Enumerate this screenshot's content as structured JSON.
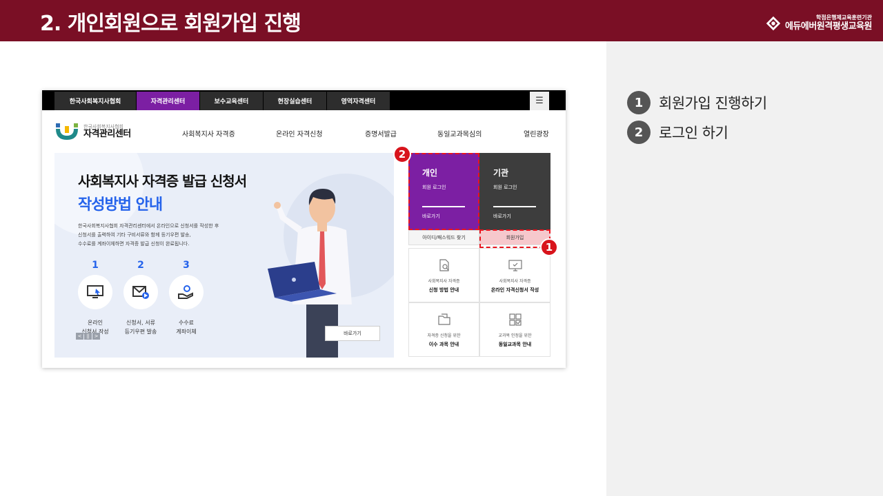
{
  "slide": {
    "title": "2. 개인회원으로 회원가입 진행",
    "brand_sub": "학점은행제교육훈련기관",
    "brand_main": "에듀에버원격평생교육원",
    "colors": {
      "header": "#7a0f25",
      "accent_purple": "#7c1fa3",
      "accent_blue": "#2563eb",
      "callout_red": "#e8141e"
    }
  },
  "steps": [
    {
      "num": "1",
      "text": "회원가입 진행하기"
    },
    {
      "num": "2",
      "text": "로그인 하기"
    }
  ],
  "site": {
    "top_nav": [
      "한국사회복지사협회",
      "자격관리센터",
      "보수교육센터",
      "현장실습센터",
      "영역자격센터"
    ],
    "top_nav_active": "자격관리센터",
    "menu_icon": "☰",
    "logo_small": "한국사회복지사협회",
    "logo_big": "자격관리센터",
    "gnb": [
      "사회복지사 자격증",
      "온라인 자격신청",
      "증명서발급",
      "동일교과목심의",
      "열린광장"
    ],
    "hero": {
      "title": "사회복지사 자격증 발급 신청서",
      "subtitle": "작성방법 안내",
      "desc": [
        "한국사회복지사협회 자격관리센터에서  온라인으로 신청서를 작성한 후",
        "신청서를 출력하여 기타 구비서류와 함께 등기우편 발송,",
        "수수료를 계좌이체하면 자격증 발급 신청이 완료됩니다."
      ],
      "steps": [
        {
          "num": "1",
          "line1": "온라인",
          "line2": "신청서 작성"
        },
        {
          "num": "2",
          "line1": "신청서, 서류",
          "line2": "등기우편 발송"
        },
        {
          "num": "3",
          "line1": "수수료",
          "line2": "계좌이체"
        }
      ],
      "slider": [
        "<",
        "||",
        ">"
      ],
      "button": "바로가기"
    },
    "login": {
      "personal_title": "개인",
      "personal_sub": "회원 로그인",
      "personal_go": "바로가기",
      "org_title": "기관",
      "org_sub": "회원 로그인",
      "org_go": "바로가기",
      "find": "아이디/패스워드 찾기",
      "join": "회원가입"
    },
    "quick": [
      {
        "icon": "doc-search-icon",
        "small": "사회복지사 자격증",
        "big": "신청 방법 안내"
      },
      {
        "icon": "monitor-icon",
        "small": "사회복지사 자격증",
        "big": "온라인 자격신청서 작성"
      },
      {
        "icon": "folder-icon",
        "small": "자격증 신청을 위한",
        "big": "이수 과목 안내"
      },
      {
        "icon": "grid-check-icon",
        "small": "교과목 인정을 위한",
        "big": "동일교과목 안내"
      }
    ]
  },
  "callouts": [
    {
      "num": "1",
      "target": "회원가입"
    },
    {
      "num": "2",
      "target": "개인"
    }
  ]
}
